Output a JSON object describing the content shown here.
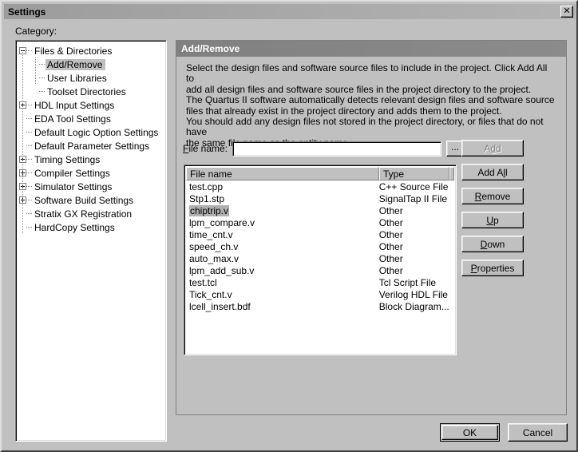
{
  "window": {
    "title": "Settings",
    "close_icon": "close-icon",
    "close_label": "✕"
  },
  "sidebar": {
    "label": "Category:",
    "items": [
      {
        "label": "Files & Directories",
        "level": 0,
        "toggle": "minus",
        "selected": false
      },
      {
        "label": "Add/Remove",
        "level": 1,
        "toggle": "none",
        "selected": true
      },
      {
        "label": "User Libraries",
        "level": 1,
        "toggle": "none",
        "selected": false
      },
      {
        "label": "Toolset Directories",
        "level": 1,
        "toggle": "none",
        "selected": false
      },
      {
        "label": "HDL Input Settings",
        "level": 0,
        "toggle": "plus",
        "selected": false
      },
      {
        "label": "EDA Tool Settings",
        "level": 0,
        "toggle": "none",
        "selected": false
      },
      {
        "label": "Default Logic Option Settings",
        "level": 0,
        "toggle": "none",
        "selected": false
      },
      {
        "label": "Default Parameter Settings",
        "level": 0,
        "toggle": "none",
        "selected": false
      },
      {
        "label": "Timing Settings",
        "level": 0,
        "toggle": "plus",
        "selected": false
      },
      {
        "label": "Compiler Settings",
        "level": 0,
        "toggle": "plus",
        "selected": false
      },
      {
        "label": "Simulator Settings",
        "level": 0,
        "toggle": "plus",
        "selected": false
      },
      {
        "label": "Software Build Settings",
        "level": 0,
        "toggle": "plus",
        "selected": false
      },
      {
        "label": "Stratix GX Registration",
        "level": 0,
        "toggle": "none",
        "selected": false
      },
      {
        "label": "HardCopy Settings",
        "level": 0,
        "toggle": "none",
        "selected": false
      }
    ]
  },
  "panel": {
    "header": "Add/Remove",
    "description_lines": [
      "Select the design files and software source files to include in the project.  Click Add All to",
      "add all design files and software source files in the project directory to the project.",
      "The Quartus II software automatically detects relevant design files and software source",
      "files that already exist in the project directory and adds them to the project.",
      "You should add any design files not stored in the project directory, or files that do not have",
      "the same file name as the entity name."
    ],
    "filename": {
      "label_pre": "F",
      "label_post": "ile name:",
      "value": "",
      "placeholder": "",
      "browse_label": "..."
    },
    "list": {
      "columns": [
        "File name",
        "Type"
      ],
      "rows": [
        {
          "name": "test.cpp",
          "type": "C++ Source File",
          "selected": false
        },
        {
          "name": "Stp1.stp",
          "type": "SignalTap II File",
          "selected": false
        },
        {
          "name": "chiptrip.v",
          "type": "Other",
          "selected": true
        },
        {
          "name": "lpm_compare.v",
          "type": "Other",
          "selected": false
        },
        {
          "name": "time_cnt.v",
          "type": "Other",
          "selected": false
        },
        {
          "name": "speed_ch.v",
          "type": "Other",
          "selected": false
        },
        {
          "name": "auto_max.v",
          "type": "Other",
          "selected": false
        },
        {
          "name": "lpm_add_sub.v",
          "type": "Other",
          "selected": false
        },
        {
          "name": "test.tcl",
          "type": "Tcl Script File",
          "selected": false
        },
        {
          "name": "Tick_cnt.v",
          "type": "Verilog HDL File",
          "selected": false
        },
        {
          "name": "lcell_insert.bdf",
          "type": "Block Diagram...",
          "selected": false
        }
      ]
    },
    "buttons": [
      {
        "name": "add",
        "pre": "A",
        "accel": "d",
        "post": "d",
        "disabled": true
      },
      {
        "name": "add-all",
        "pre": "Add A",
        "accel": "l",
        "post": "l",
        "disabled": false
      },
      {
        "name": "remove",
        "pre": "",
        "accel": "R",
        "post": "emove",
        "disabled": false
      },
      {
        "name": "up",
        "pre": "",
        "accel": "U",
        "post": "p",
        "disabled": false
      },
      {
        "name": "down",
        "pre": "",
        "accel": "D",
        "post": "own",
        "disabled": false
      },
      {
        "name": "properties",
        "pre": "",
        "accel": "P",
        "post": "roperties",
        "disabled": false
      }
    ]
  },
  "footer": {
    "ok": "OK",
    "cancel": "Cancel"
  }
}
